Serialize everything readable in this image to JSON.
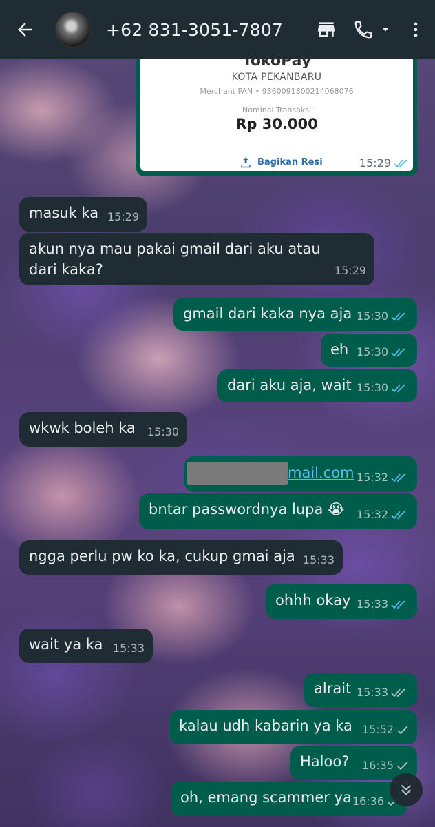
{
  "header": {
    "contact_name": "+62 831-3051-7807",
    "back_icon": "arrow-left-icon",
    "store_icon": "store-icon",
    "call_icon": "phone-icon",
    "menu_icon": "more-vert-icon"
  },
  "colors": {
    "topbar": "#1f2c34",
    "incoming_bubble": "#1f2c34",
    "outgoing_bubble": "#005c4b",
    "read_tick": "#53bdeb",
    "text": "#e9edef"
  },
  "image_message": {
    "brand": "TokoPay",
    "city": "KOTA PEKANBARU",
    "merchant_pan": "Merchant PAN • 9360091800214068076",
    "nominal_label": "Nominal Transaksi",
    "amount": "Rp 30.000",
    "share_label": "Bagikan Resi",
    "time": "15:29",
    "status": "read"
  },
  "messages": [
    {
      "dir": "in",
      "text": "masuk ka",
      "time": "15:29"
    },
    {
      "dir": "in",
      "text": "akun nya mau pakai gmail dari aku atau dari kaka?",
      "time": "15:29"
    },
    {
      "dir": "out",
      "text": "gmail dari kaka nya aja",
      "time": "15:30",
      "status": "read"
    },
    {
      "dir": "out",
      "text": "eh",
      "time": "15:30",
      "status": "read"
    },
    {
      "dir": "out",
      "text": "dari aku aja, wait",
      "time": "15:30",
      "status": "read"
    },
    {
      "dir": "in",
      "text": "wkwk boleh ka",
      "time": "15:30"
    },
    {
      "dir": "out",
      "text": "mail.com",
      "time": "15:32",
      "status": "read",
      "redacted_prefix": true
    },
    {
      "dir": "out",
      "text": "bntar passwordnya lupa 😭",
      "time": "15:32",
      "status": "read"
    },
    {
      "dir": "in",
      "text": "ngga perlu pw ko ka, cukup gmai aja",
      "time": "15:33"
    },
    {
      "dir": "out",
      "text": "ohhh okay",
      "time": "15:33",
      "status": "read"
    },
    {
      "dir": "in",
      "text": "wait ya ka",
      "time": "15:33"
    },
    {
      "dir": "out",
      "text": "alrait",
      "time": "15:33",
      "status": "delivered"
    },
    {
      "dir": "out",
      "text": "kalau udh kabarin ya ka",
      "time": "15:52",
      "status": "sent"
    },
    {
      "dir": "out",
      "text": "Haloo?",
      "time": "16:35",
      "status": "sent"
    },
    {
      "dir": "out",
      "text": "oh, emang scammer ya",
      "time": "16:36",
      "status": "sent"
    }
  ],
  "scroll_button_icon": "double-chevron-down-icon"
}
